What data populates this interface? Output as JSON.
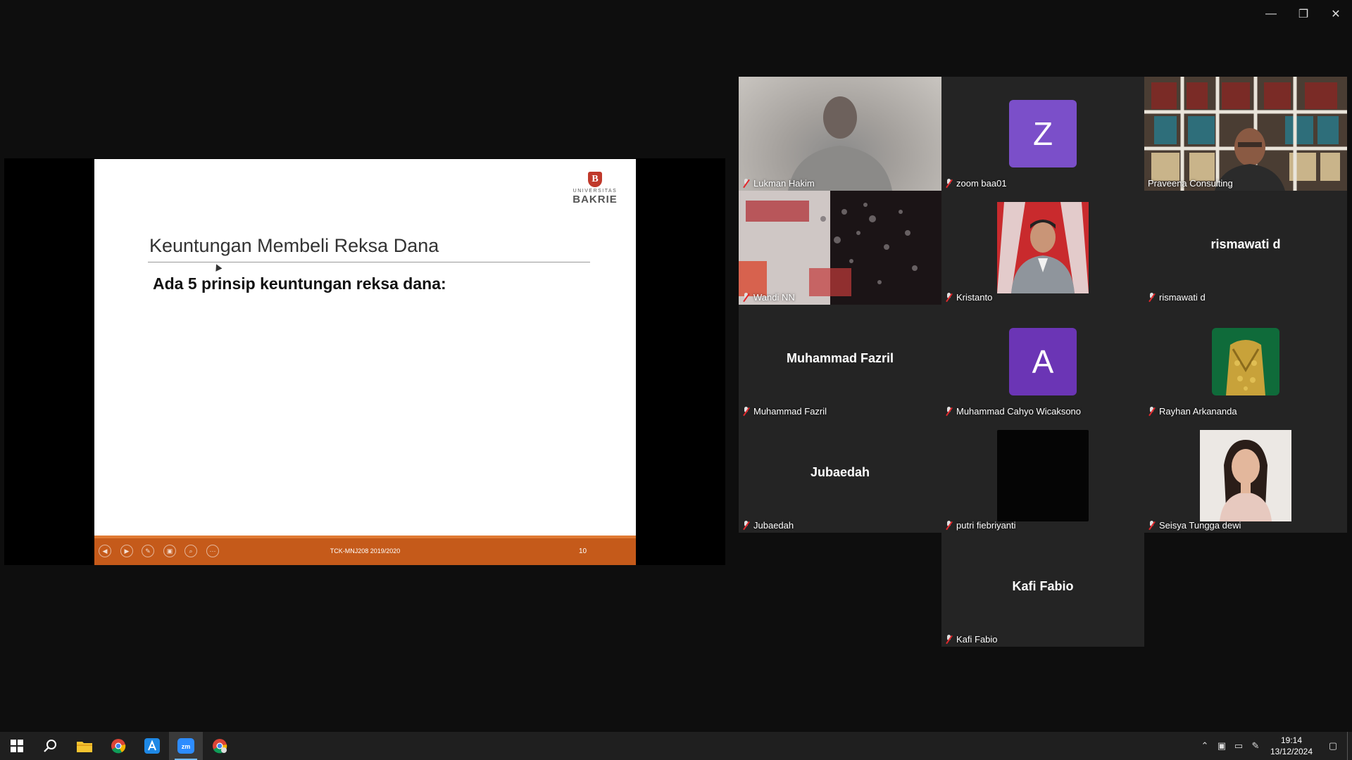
{
  "window_controls": {
    "minimize": "—",
    "restore": "❐",
    "close": "✕"
  },
  "slide": {
    "logo_small": "UNIVERSITAS",
    "logo_big": "BAKRIE",
    "logo_mark": "B",
    "title": "Keuntungan Membeli Reksa Dana",
    "subtitle": "Ada 5 prinsip keuntungan reksa dana:",
    "footer": "TCK-MNJ208  2019/2020",
    "page_number": "10",
    "controls": [
      "◀",
      "▶",
      "✎",
      "▣",
      "⌕",
      "⋯"
    ]
  },
  "participants": [
    {
      "name": "Lukman Hakim",
      "type": "video"
    },
    {
      "name": "zoom baa01",
      "type": "letter",
      "letter": "Z",
      "color": "#7b4fc9"
    },
    {
      "name": "Praveena Consulting",
      "type": "video",
      "speaking": true
    },
    {
      "name": "Wandi NN",
      "type": "video"
    },
    {
      "name": "Kristanto",
      "type": "photo"
    },
    {
      "name": "rismawati d",
      "type": "name",
      "display": "rismawati d"
    },
    {
      "name": "Muhammad Fazril",
      "type": "name",
      "display": "Muhammad Fazril"
    },
    {
      "name": "Muhammad Cahyo Wicaksono",
      "type": "letter",
      "letter": "A",
      "color": "#6b35b5"
    },
    {
      "name": "Rayhan Arkananda",
      "type": "photo"
    },
    {
      "name": "Jubaedah",
      "type": "name",
      "display": "Jubaedah"
    },
    {
      "name": "putri fiebriyanti",
      "type": "photo"
    },
    {
      "name": "Seisya Tungga dewi",
      "type": "photo"
    },
    {
      "name": "Kafi Fabio",
      "type": "name",
      "display": "Kafi Fabio"
    }
  ],
  "taskbar": {
    "apps": [
      "start-icon",
      "search-icon",
      "file-explorer-icon",
      "chrome-icon",
      "app-store-icon",
      "zoom-icon",
      "chrome-profile-icon"
    ],
    "time": "19:14",
    "date": "13/12/2024"
  }
}
